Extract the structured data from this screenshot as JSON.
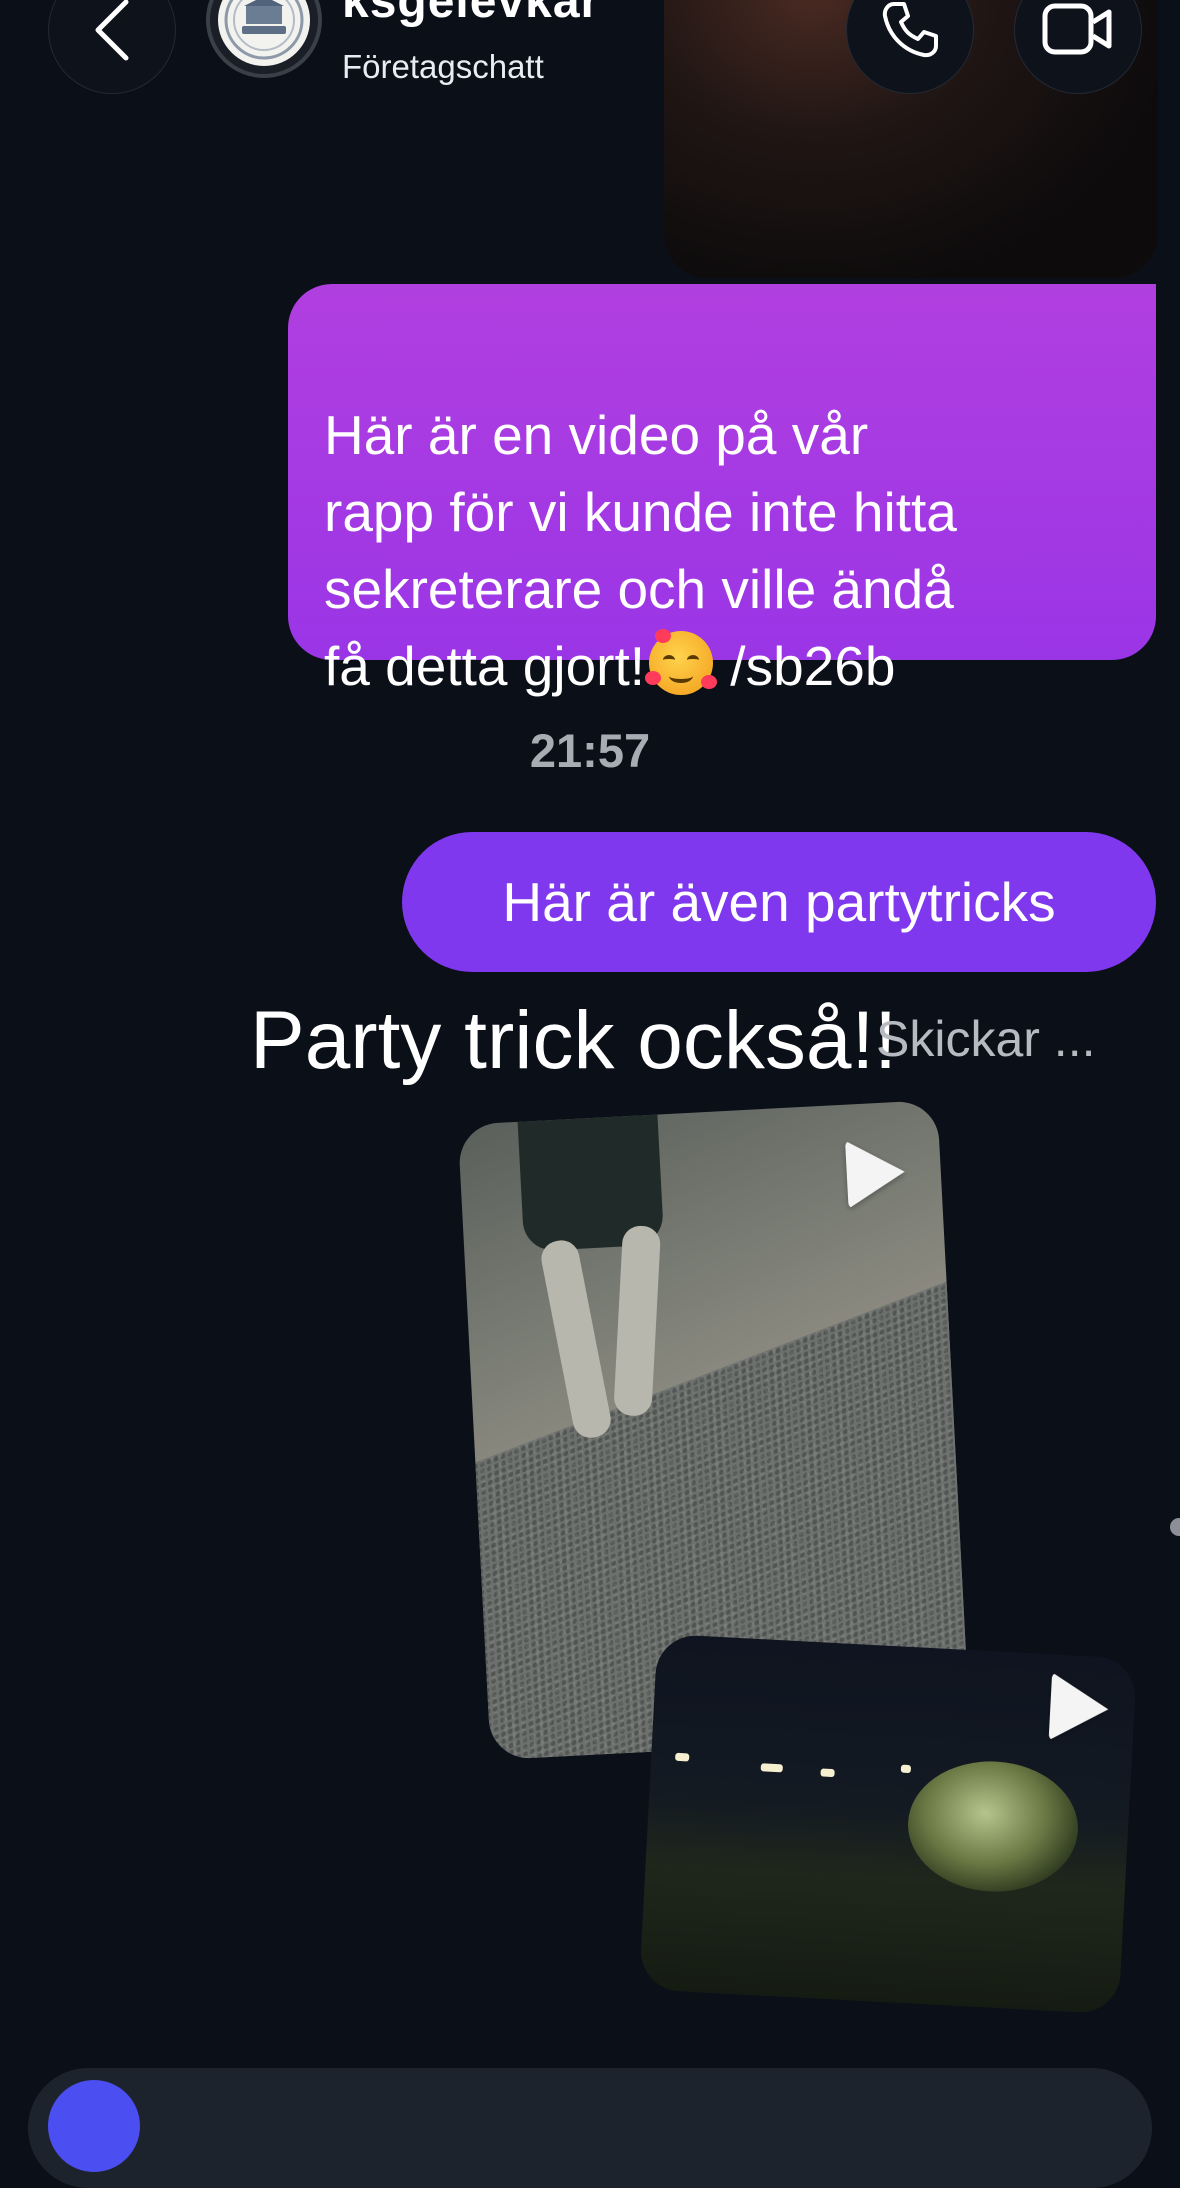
{
  "header": {
    "chat_name": "ksgelevkar",
    "chat_subtitle": "Företagschatt",
    "avatar_seal_text": "STYRELSEN"
  },
  "messages": {
    "bubble_1": "Här är en video på vår\nrapp för vi kunde inte hitta\nsekreterare och ville ändå\nfå detta gjort!",
    "bubble_1_tail": " /sb26b",
    "bubble_1_emoji": "smiling-face-with-hearts-icon",
    "timestamp": "21:57",
    "bubble_2": "Här är även partytricks",
    "overlay_caption": "Party trick också!!",
    "sending_status": "Skickar ..."
  },
  "colors": {
    "background": "#0b0f17",
    "bubble_gradient_top": "#b13fe0",
    "bubble_solid": "#7f38ee",
    "composer_button": "#4b4ef0"
  }
}
